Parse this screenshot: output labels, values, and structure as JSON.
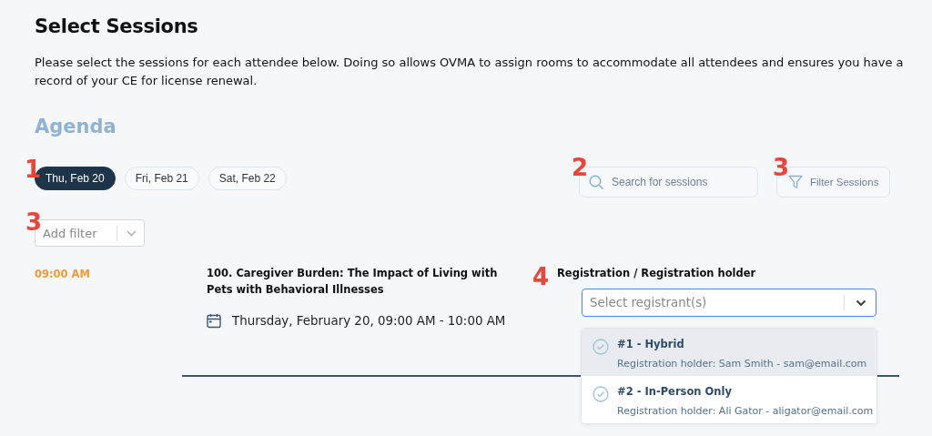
{
  "heading": "Select Sessions",
  "intro": "Please select the sessions for each attendee below. Doing so allows OVMA to assign rooms to accommodate all attendees and ensures you have a record of your CE for license renewal.",
  "agenda_title": "Agenda",
  "days_marker": "1",
  "days": [
    {
      "label": "Thu, Feb 20",
      "selected": true
    },
    {
      "label": "Fri, Feb 21",
      "selected": false
    },
    {
      "label": "Sat, Feb 22",
      "selected": false
    }
  ],
  "search": {
    "marker": "2",
    "placeholder": "Search for sessions"
  },
  "filter_button": {
    "marker": "3",
    "label": "Filter Sessions"
  },
  "add_filter": {
    "marker": "3",
    "placeholder": "Add filter"
  },
  "sessions": [
    {
      "time": "09:00 AM",
      "title": "100. Caregiver Burden: The Impact of Living with Pets with Behavioral Illnesses",
      "schedule": "Thursday, February 20, 09:00 AM - 10:00 AM",
      "registrant_marker": "4",
      "registrant_label": "Registration / Registration holder",
      "registrant_select": {
        "placeholder": "Select registrant(s)",
        "expanded": true,
        "options": [
          {
            "title": "#1 - Hybrid",
            "detail": "Registration holder: Sam Smith - sam@email.com",
            "highlighted": true
          },
          {
            "title": "#2 - In-Person Only",
            "detail": "Registration holder: Ali Gator - aligator@email.com",
            "highlighted": false
          }
        ]
      }
    }
  ]
}
